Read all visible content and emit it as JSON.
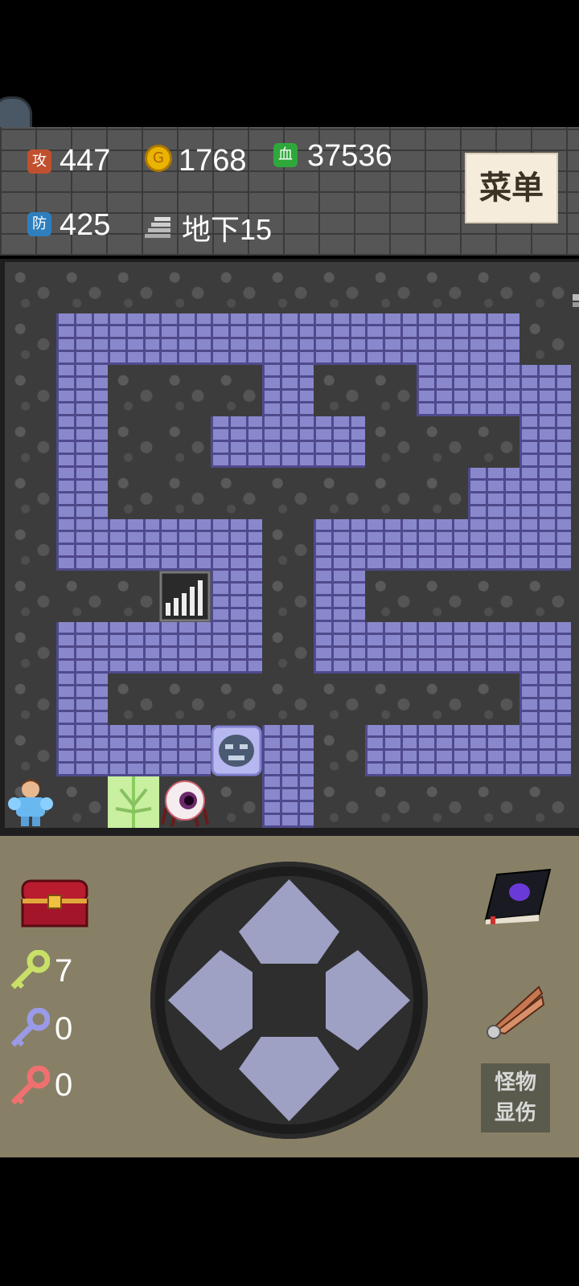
{
  "stats": {
    "attack_badge": "攻",
    "attack": "447",
    "gold_badge": "G",
    "gold": "1768",
    "hp_badge": "血",
    "hp": "37536",
    "defense_badge": "防",
    "defense": "425",
    "floor": "地下15"
  },
  "menu": {
    "label": "菜单"
  },
  "keys": {
    "yellow": "7",
    "blue": "0",
    "red": "0"
  },
  "buttons": {
    "monster_damage": "怪物\n显伤"
  },
  "colors": {
    "wall": "#8a88cc",
    "floor": "#3c3c3c",
    "panel": "#888066",
    "menu_bg": "#f5ecdc"
  },
  "icons": {
    "inventory": "treasure-chest-icon",
    "monster_book": "book-icon",
    "fly": "wing-icon",
    "yellow_key": "yellow-key-icon",
    "blue_key": "blue-key-icon",
    "red_key": "red-key-icon"
  },
  "map": {
    "floor": "地下15",
    "rows": [
      "FFFFFFFFFFFU",
      "FWWWWWWWWWFF",
      "FWIIIWIIWWWF",
      "FWIIWWWIIIWF",
      "FWIIIIIIIWWF",
      "FWWWWFWWWWWF",
      "FFFDWFWFFFFF",
      "FWWWWFWWWWWF",
      "FWIIIIIIIIWF",
      "FWWWMWFWWWWF",
      "HFGEFWFFFFFF"
    ],
    "legend": {
      "F": "floor",
      "W": "wall",
      "I": "enclosed floor",
      "U": "stairs-up",
      "D": "stairs-down",
      "M": "stone-monster",
      "H": "hero",
      "G": "green-door",
      "E": "eyeball-monster"
    }
  }
}
